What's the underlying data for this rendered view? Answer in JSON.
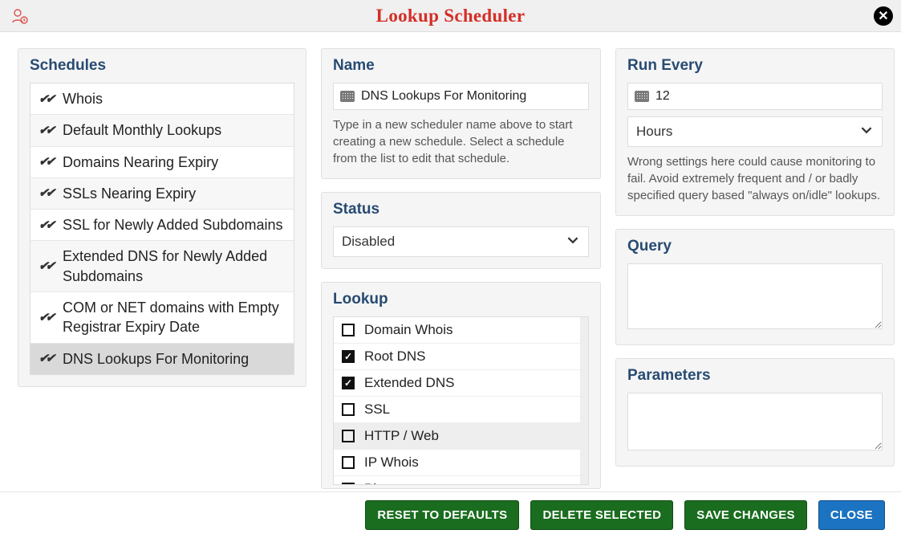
{
  "title": "Lookup Scheduler",
  "schedules": {
    "heading": "Schedules",
    "items": [
      {
        "label": "Whois"
      },
      {
        "label": "Default Monthly Lookups"
      },
      {
        "label": "Domains Nearing Expiry"
      },
      {
        "label": "SSLs Nearing Expiry"
      },
      {
        "label": "SSL for Newly Added Subdomains"
      },
      {
        "label": "Extended DNS for Newly Added Subdomains"
      },
      {
        "label": "COM or NET domains with Empty Registrar Expiry Date"
      },
      {
        "label": "DNS Lookups For Monitoring"
      }
    ],
    "selected_index": 7
  },
  "name": {
    "heading": "Name",
    "value": "DNS Lookups For Monitoring",
    "helper": "Type in a new scheduler name above to start creating a new schedule. Select a schedule from the list to edit that schedule."
  },
  "status": {
    "heading": "Status",
    "value": "Disabled"
  },
  "lookup": {
    "heading": "Lookup",
    "items": [
      {
        "label": "Domain Whois",
        "checked": false
      },
      {
        "label": "Root DNS",
        "checked": true
      },
      {
        "label": "Extended DNS",
        "checked": true
      },
      {
        "label": "SSL",
        "checked": false
      },
      {
        "label": "HTTP / Web",
        "checked": false
      },
      {
        "label": "IP Whois",
        "checked": false
      },
      {
        "label": "Ping",
        "checked": false
      }
    ]
  },
  "run_every": {
    "heading": "Run Every",
    "value": "12",
    "unit": "Hours",
    "helper": "Wrong settings here could cause monitoring to fail. Avoid extremely frequent and / or badly specified query based \"always on/idle\" lookups."
  },
  "query": {
    "heading": "Query",
    "value": ""
  },
  "parameters": {
    "heading": "Parameters",
    "value": ""
  },
  "footer": {
    "reset": "RESET TO DEFAULTS",
    "delete": "DELETE SELECTED",
    "save": "SAVE CHANGES",
    "close": "CLOSE"
  }
}
